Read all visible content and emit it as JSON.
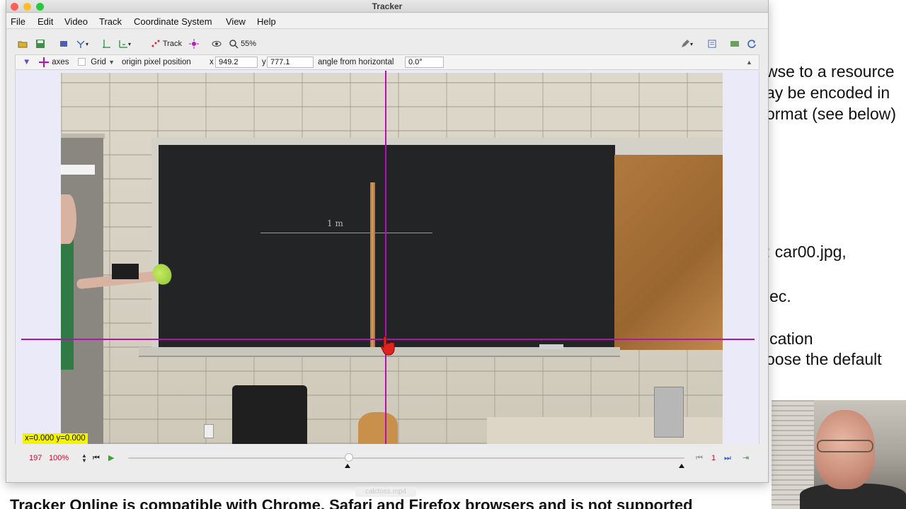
{
  "window": {
    "title": "Tracker"
  },
  "menu": [
    "File",
    "Edit",
    "Video",
    "Track",
    "Coordinate System",
    "View",
    "Help"
  ],
  "toolbar": {
    "track_label": "Track",
    "zoom": "55%"
  },
  "coordbar": {
    "axes_label": "axes",
    "grid_label": "Grid",
    "origin_label": "origin pixel position",
    "x_label": "x",
    "x_value": "949.2",
    "y_label": "y",
    "y_value": "777.1",
    "angle_label": "angle from horizontal",
    "angle_value": "0.0°"
  },
  "video": {
    "readout": "x=0.000  y=0.000",
    "chalk_text": "1 m"
  },
  "player": {
    "frame": "197",
    "rate": "100%",
    "step": "1"
  },
  "status": {
    "file_name": "calctoss.mp4"
  },
  "background_doc": {
    "lines": [
      "wse to a resource",
      "ay be encoded in",
      "ormat (see below)",
      ": car00.jpg,",
      "lec.",
      "ication",
      "oose the default"
    ],
    "bottom_text": "Tracker Online is compatible with Chrome, Safari and Firefox browsers and is not supported"
  },
  "colors": {
    "axes": "#b70fb3",
    "readout_bg": "#f4f400",
    "frame_text": "#c8102e"
  }
}
